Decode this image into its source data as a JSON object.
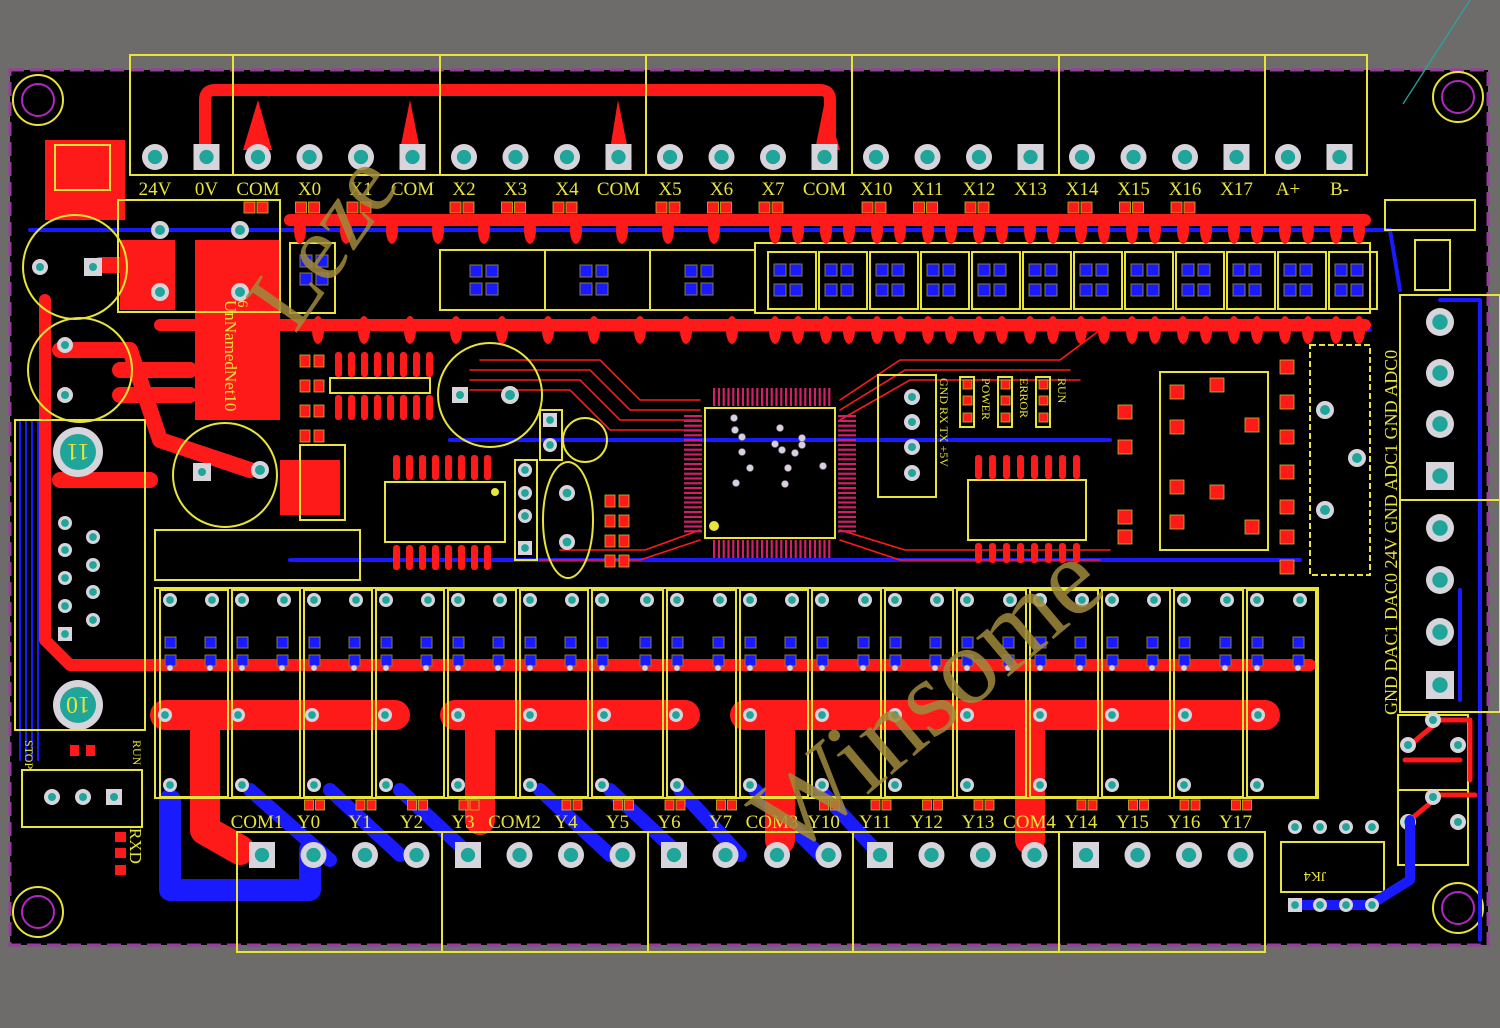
{
  "view": {
    "type": "PCB layout editor canvas",
    "background_color": "#6e6c6b",
    "board_color": "#000000",
    "layer_colors": {
      "top_copper": "#ff1a1a",
      "bottom_copper": "#1a1aff",
      "silkscreen": "#e8e43a",
      "keepout_outline": "#9a3aa0",
      "ratsnest": "#2aa39b",
      "pad_hole": "#1fa59a"
    }
  },
  "top_connector": {
    "labels": [
      "24V",
      "0V",
      "COM",
      "X0",
      "X1",
      "COM",
      "X2",
      "X3",
      "X4",
      "COM",
      "X5",
      "X6",
      "X7",
      "COM",
      "X10",
      "X11",
      "X12",
      "X13",
      "X14",
      "X15",
      "X16",
      "X17",
      "A+",
      "B-"
    ],
    "square_pad_indices": [
      1,
      5,
      9,
      13,
      17,
      21,
      23
    ]
  },
  "bottom_connector": {
    "labels": [
      "COM1",
      "Y0",
      "Y1",
      "Y2",
      "Y3",
      "COM2",
      "Y4",
      "Y5",
      "Y6",
      "Y7",
      "COM3",
      "Y10",
      "Y11",
      "Y12",
      "Y13",
      "COM4",
      "Y14",
      "Y15",
      "Y16",
      "Y17"
    ],
    "square_pad_indices": [
      0,
      4,
      8,
      12,
      16
    ]
  },
  "right_connector": {
    "labels_bottom_to_top": [
      "GND",
      "DAC1",
      "DAC0",
      "24V",
      "GND",
      "ADC1",
      "GND",
      "ADC0"
    ],
    "square_pad_indices_top_to_bottom": [
      3,
      7
    ]
  },
  "status_leds": [
    "POWER",
    "ERROR",
    "RUN"
  ],
  "serial_header": {
    "label": "GND RX TX +5V"
  },
  "switch": {
    "left": "STOP",
    "right": "RUN"
  },
  "rxd_label": "RXD",
  "jk4_label": "JK4",
  "power_net_label": "UnNamedNet10",
  "power_net_sub": "6",
  "db9_mount_labels": {
    "top": "11",
    "bottom": "10"
  },
  "watermarks": [
    "Leze",
    "Winsome"
  ]
}
